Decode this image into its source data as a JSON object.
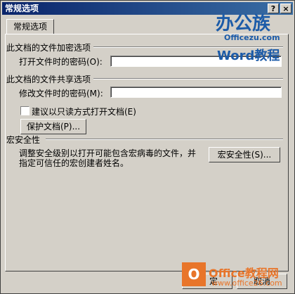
{
  "window": {
    "title": "常规选项",
    "help_glyph": "?",
    "close_glyph": "×"
  },
  "tabs": [
    {
      "label": "常规选项"
    }
  ],
  "encrypt": {
    "section_title": "此文档的文件加密选项",
    "open_password_label": "打开文件时的密码(O):",
    "open_password_value": ""
  },
  "share": {
    "section_title": "此文档的文件共享选项",
    "modify_password_label": "修改文件时的密码(M):",
    "modify_password_value": "",
    "readonly_label": "建议以只读方式打开文档(E)",
    "readonly_checked": false,
    "protect_button": "保护文档(P)..."
  },
  "macro": {
    "section_title": "宏安全性",
    "description_line1": "调整安全级别以打开可能包含宏病毒的文件，并",
    "description_line2": "指定可信任的宏创建者姓名。",
    "button": "宏安全性(S)..."
  },
  "footer": {
    "ok_partial": "定",
    "cancel_partial": "取消"
  },
  "watermarks": {
    "top_logo_line1": "办公族",
    "top_logo_line2": "Officezu.com",
    "top_logo_line3": "Word教程",
    "bottom_logo_title": "Office教程网",
    "bottom_logo_url": "www.office26.com",
    "bottom_logo_box": "O"
  },
  "colors": {
    "titlebar_start": "#0a246a",
    "titlebar_end": "#3a6ea5",
    "face": "#d4d0c8",
    "watermark_blue": "#1c5ba8",
    "watermark_orange": "#e8752a"
  }
}
